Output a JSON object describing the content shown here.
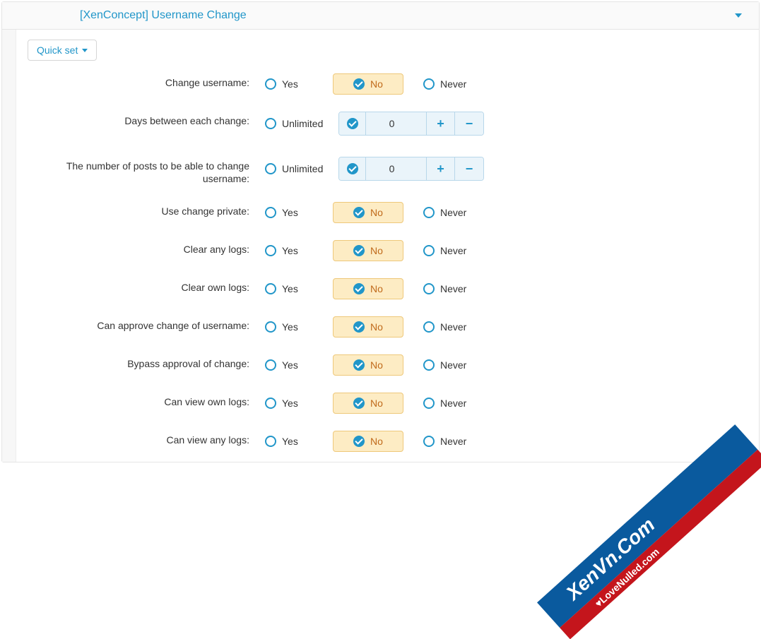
{
  "panel": {
    "title": "[XenConcept] Username Change",
    "quick_set": "Quick set"
  },
  "options": {
    "yes": "Yes",
    "no": "No",
    "never": "Never",
    "unlimited": "Unlimited"
  },
  "rows": [
    {
      "label": "Change username:",
      "type": "yesno",
      "selected": "no"
    },
    {
      "label": "Days between each change:",
      "type": "numeric",
      "value": "0"
    },
    {
      "label": "The number of posts to be able to change username:",
      "type": "numeric",
      "value": "0"
    },
    {
      "label": "Use change private:",
      "type": "yesno",
      "selected": "no"
    },
    {
      "label": "Clear any logs:",
      "type": "yesno",
      "selected": "no"
    },
    {
      "label": "Clear own logs:",
      "type": "yesno",
      "selected": "no"
    },
    {
      "label": "Can approve change of username:",
      "type": "yesno",
      "selected": "no"
    },
    {
      "label": "Bypass approval of change:",
      "type": "yesno",
      "selected": "no"
    },
    {
      "label": "Can view own logs:",
      "type": "yesno",
      "selected": "no"
    },
    {
      "label": "Can view any logs:",
      "type": "yesno",
      "selected": "no"
    }
  ],
  "watermark": {
    "line1": "XenVn.Com",
    "line2": "LoveNulled.com"
  }
}
